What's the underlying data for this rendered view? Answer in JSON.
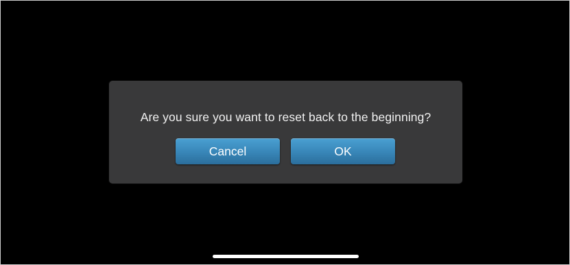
{
  "dialog": {
    "message": "Are you sure you want to reset back to the beginning?",
    "cancel_label": "Cancel",
    "ok_label": "OK"
  },
  "colors": {
    "background": "#000000",
    "dialog_background": "#39393a",
    "button_blue": "#3a89bb",
    "text": "#f2f2f2"
  }
}
